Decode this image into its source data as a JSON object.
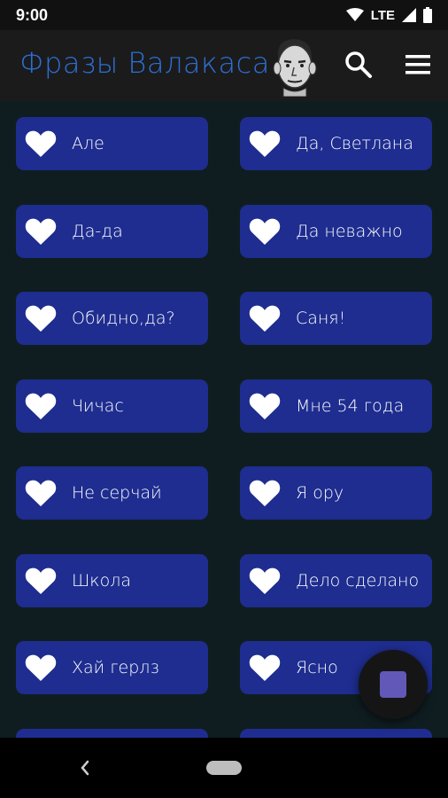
{
  "status_bar": {
    "time": "9:00",
    "network": "LTE"
  },
  "app_bar": {
    "title": "Фразы Валакаса",
    "title_color": "#2d6fd6",
    "icons": [
      "avatar-portrait",
      "search-icon",
      "menu-icon"
    ]
  },
  "phrases": [
    {
      "label": "Але"
    },
    {
      "label": "Да, Светлана"
    },
    {
      "label": "Да-да"
    },
    {
      "label": "Да неважно"
    },
    {
      "label": "Обидно,да?"
    },
    {
      "label": "Саня!"
    },
    {
      "label": "Чичас"
    },
    {
      "label": "Мне 54 года"
    },
    {
      "label": "Не серчай"
    },
    {
      "label": "Я ору"
    },
    {
      "label": "Школа"
    },
    {
      "label": "Дело сделано"
    },
    {
      "label": "Хай герлз"
    },
    {
      "label": "Ясно"
    },
    {
      "label": ""
    },
    {
      "label": ""
    }
  ],
  "colors": {
    "card": "#1e2d8f",
    "background": "#0f1d21",
    "fab_icon": "#6158b7"
  },
  "fab": {
    "icon": "stop-icon"
  }
}
